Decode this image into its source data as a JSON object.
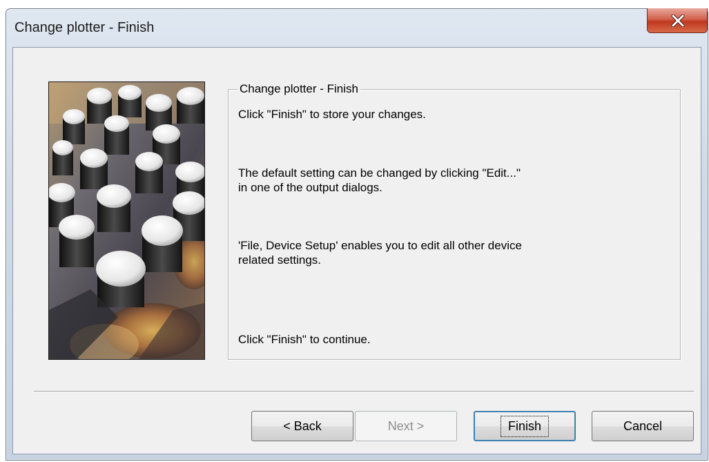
{
  "window": {
    "title": "Change plotter - Finish"
  },
  "group": {
    "legend": "Change plotter - Finish",
    "paragraph1": "Click \"Finish\" to store your changes.",
    "paragraph2_line1": "The default setting can be changed by clicking \"Edit...\"",
    "paragraph2_line2": "in one of the output dialogs.",
    "paragraph3_line1": "'File, Device Setup' enables you to edit all other device",
    "paragraph3_line2": "related settings.",
    "paragraph4": "Click \"Finish\" to continue."
  },
  "buttons": {
    "back": "< Back",
    "next": "Next >",
    "finish": "Finish",
    "cancel": "Cancel"
  },
  "icons": {
    "close": "close-icon",
    "picture": "wizard-image-lenses"
  },
  "colors": {
    "close_button": "#c8442a",
    "client_background": "#f0f0f0"
  }
}
